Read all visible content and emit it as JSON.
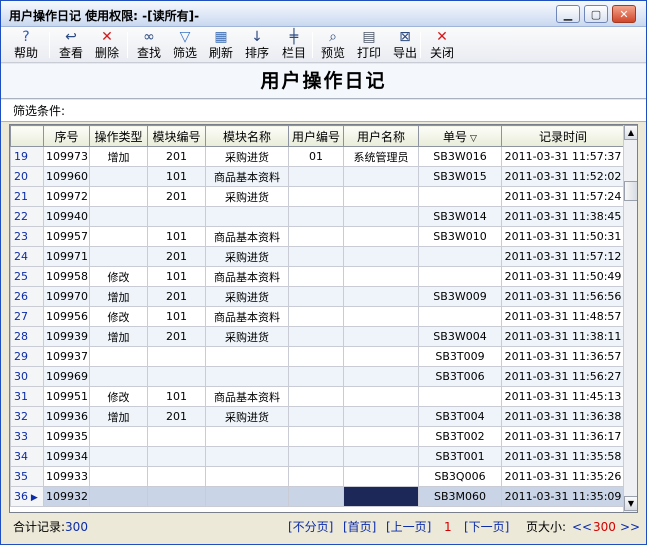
{
  "window": {
    "title": "用户操作日记  使用权限: -[读所有]-"
  },
  "toolbar": [
    {
      "name": "help",
      "label": "帮助",
      "icon": "help-icon",
      "glyph": "?",
      "color": "#2d5fb8"
    },
    {
      "name": "view",
      "label": "查看",
      "icon": "view-icon",
      "glyph": "↩",
      "color": "#2c4a80"
    },
    {
      "name": "delete",
      "label": "删除",
      "icon": "delete-icon",
      "glyph": "✕",
      "color": "#d11c1c"
    },
    {
      "name": "find",
      "label": "查找",
      "icon": "binoculars-icon",
      "glyph": "∞",
      "color": "#2c4a80"
    },
    {
      "name": "filter",
      "label": "筛选",
      "icon": "funnel-icon",
      "glyph": "▽",
      "color": "#3975c3"
    },
    {
      "name": "refresh",
      "label": "刷新",
      "icon": "refresh-icon",
      "glyph": "▦",
      "color": "#3c6db3"
    },
    {
      "name": "sort",
      "label": "排序",
      "icon": "sort-icon",
      "glyph": "↓",
      "color": "#2c4a80"
    },
    {
      "name": "columns",
      "label": "栏目",
      "icon": "columns-icon",
      "glyph": "╪",
      "color": "#2c4a80"
    },
    {
      "name": "preview",
      "label": "预览",
      "icon": "magnifier-icon",
      "glyph": "⌕",
      "color": "#2c4a80"
    },
    {
      "name": "print",
      "label": "打印",
      "icon": "printer-icon",
      "glyph": "▤",
      "color": "#4d5668"
    },
    {
      "name": "export",
      "label": "导出",
      "icon": "export-icon",
      "glyph": "⊠",
      "color": "#2c4a80"
    },
    {
      "name": "close",
      "label": "关闭",
      "icon": "close-icon",
      "glyph": "✕",
      "color": "#d11c1c"
    }
  ],
  "header": {
    "title": "用户操作日记"
  },
  "filter": {
    "label": "筛选条件:"
  },
  "grid": {
    "columns": [
      "序号",
      "操作类型",
      "模块编号",
      "模块名称",
      "用户编号",
      "用户名称",
      "单号",
      "记录时间"
    ],
    "rows": [
      {
        "n": "19",
        "seq": "109973",
        "op": "增加",
        "mod": "201",
        "modName": "采购进货",
        "uid": "01",
        "uname": "系统管理员",
        "doc": "SB3W016",
        "time": "2011-03-31  11:57:37"
      },
      {
        "n": "20",
        "seq": "109960",
        "op": "",
        "mod": "101",
        "modName": "商品基本资料",
        "uid": "",
        "uname": "",
        "doc": "SB3W015",
        "time": "2011-03-31  11:52:02"
      },
      {
        "n": "21",
        "seq": "109972",
        "op": "",
        "mod": "201",
        "modName": "采购进货",
        "uid": "",
        "uname": "",
        "doc": "",
        "time": "2011-03-31  11:57:24"
      },
      {
        "n": "22",
        "seq": "109940",
        "op": "",
        "mod": "",
        "modName": "",
        "uid": "",
        "uname": "",
        "doc": "SB3W014",
        "time": "2011-03-31  11:38:45"
      },
      {
        "n": "23",
        "seq": "109957",
        "op": "",
        "mod": "101",
        "modName": "商品基本资料",
        "uid": "",
        "uname": "",
        "doc": "SB3W010",
        "time": "2011-03-31  11:50:31"
      },
      {
        "n": "24",
        "seq": "109971",
        "op": "",
        "mod": "201",
        "modName": "采购进货",
        "uid": "",
        "uname": "",
        "doc": "",
        "time": "2011-03-31  11:57:12"
      },
      {
        "n": "25",
        "seq": "109958",
        "op": "修改",
        "mod": "101",
        "modName": "商品基本资料",
        "uid": "",
        "uname": "",
        "doc": "",
        "time": "2011-03-31  11:50:49"
      },
      {
        "n": "26",
        "seq": "109970",
        "op": "增加",
        "mod": "201",
        "modName": "采购进货",
        "uid": "",
        "uname": "",
        "doc": "SB3W009",
        "time": "2011-03-31  11:56:56"
      },
      {
        "n": "27",
        "seq": "109956",
        "op": "修改",
        "mod": "101",
        "modName": "商品基本资料",
        "uid": "",
        "uname": "",
        "doc": "",
        "time": "2011-03-31  11:48:57"
      },
      {
        "n": "28",
        "seq": "109939",
        "op": "增加",
        "mod": "201",
        "modName": "采购进货",
        "uid": "",
        "uname": "",
        "doc": "SB3W004",
        "time": "2011-03-31  11:38:11"
      },
      {
        "n": "29",
        "seq": "109937",
        "op": "",
        "mod": "",
        "modName": "",
        "uid": "",
        "uname": "",
        "doc": "SB3T009",
        "time": "2011-03-31  11:36:57"
      },
      {
        "n": "30",
        "seq": "109969",
        "op": "",
        "mod": "",
        "modName": "",
        "uid": "",
        "uname": "",
        "doc": "SB3T006",
        "time": "2011-03-31  11:56:27"
      },
      {
        "n": "31",
        "seq": "109951",
        "op": "修改",
        "mod": "101",
        "modName": "商品基本资料",
        "uid": "",
        "uname": "",
        "doc": "",
        "time": "2011-03-31  11:45:13"
      },
      {
        "n": "32",
        "seq": "109936",
        "op": "增加",
        "mod": "201",
        "modName": "采购进货",
        "uid": "",
        "uname": "",
        "doc": "SB3T004",
        "time": "2011-03-31  11:36:38"
      },
      {
        "n": "33",
        "seq": "109935",
        "op": "",
        "mod": "",
        "modName": "",
        "uid": "",
        "uname": "",
        "doc": "SB3T002",
        "time": "2011-03-31  11:36:17"
      },
      {
        "n": "34",
        "seq": "109934",
        "op": "",
        "mod": "",
        "modName": "",
        "uid": "",
        "uname": "",
        "doc": "SB3T001",
        "time": "2011-03-31  11:35:58"
      },
      {
        "n": "35",
        "seq": "109933",
        "op": "",
        "mod": "",
        "modName": "",
        "uid": "",
        "uname": "",
        "doc": "SB3Q006",
        "time": "2011-03-31  11:35:26"
      },
      {
        "n": "36",
        "seq": "109932",
        "op": "",
        "mod": "",
        "modName": "",
        "uid": "",
        "uname": "",
        "doc": "SB3M060",
        "time": "2011-03-31  11:35:09"
      }
    ],
    "selected_row": "36"
  },
  "footer": {
    "total_label": "合计记录:",
    "total_value": "300",
    "no_paging": "[不分页]",
    "first": "[首页]",
    "prev": "[上一页]",
    "current_page": "1",
    "next": "[下一页]",
    "page_size_label": "页大小:",
    "page_size": "300",
    "dec_glyph": "<<",
    "inc_glyph": ">>"
  },
  "colors": {
    "link": "#0b2ba8",
    "accent_red": "#d20000",
    "selected_cell": "#1c2857"
  }
}
